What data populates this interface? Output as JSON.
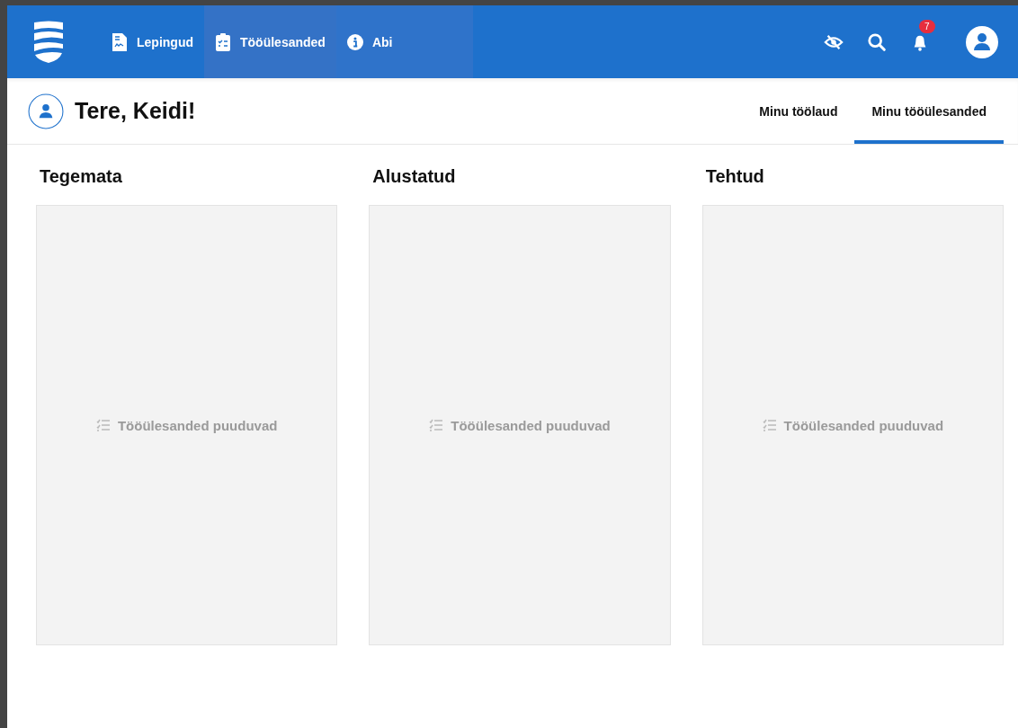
{
  "nav": {
    "items": [
      {
        "kind": "contract",
        "label": "Lepingud",
        "selected": false,
        "hovered": false
      },
      {
        "kind": "tasks",
        "label": "Tööülesanded",
        "selected": true,
        "hovered": false
      },
      {
        "kind": "info",
        "label": "Abi",
        "selected": false,
        "hovered": true
      }
    ],
    "notification_count": "7"
  },
  "greeting": "Tere, Keidi!",
  "tabs": [
    {
      "label": "Minu töölaud",
      "selected": false
    },
    {
      "label": "Minu tööülesanded",
      "selected": true
    }
  ],
  "columns": [
    {
      "title": "Tegemata",
      "empty_text": "Tööülesanded puuduvad"
    },
    {
      "title": "Alustatud",
      "empty_text": "Tööülesanded puuduvad"
    },
    {
      "title": "Tehtud",
      "empty_text": "Tööülesanded puuduvad"
    }
  ]
}
